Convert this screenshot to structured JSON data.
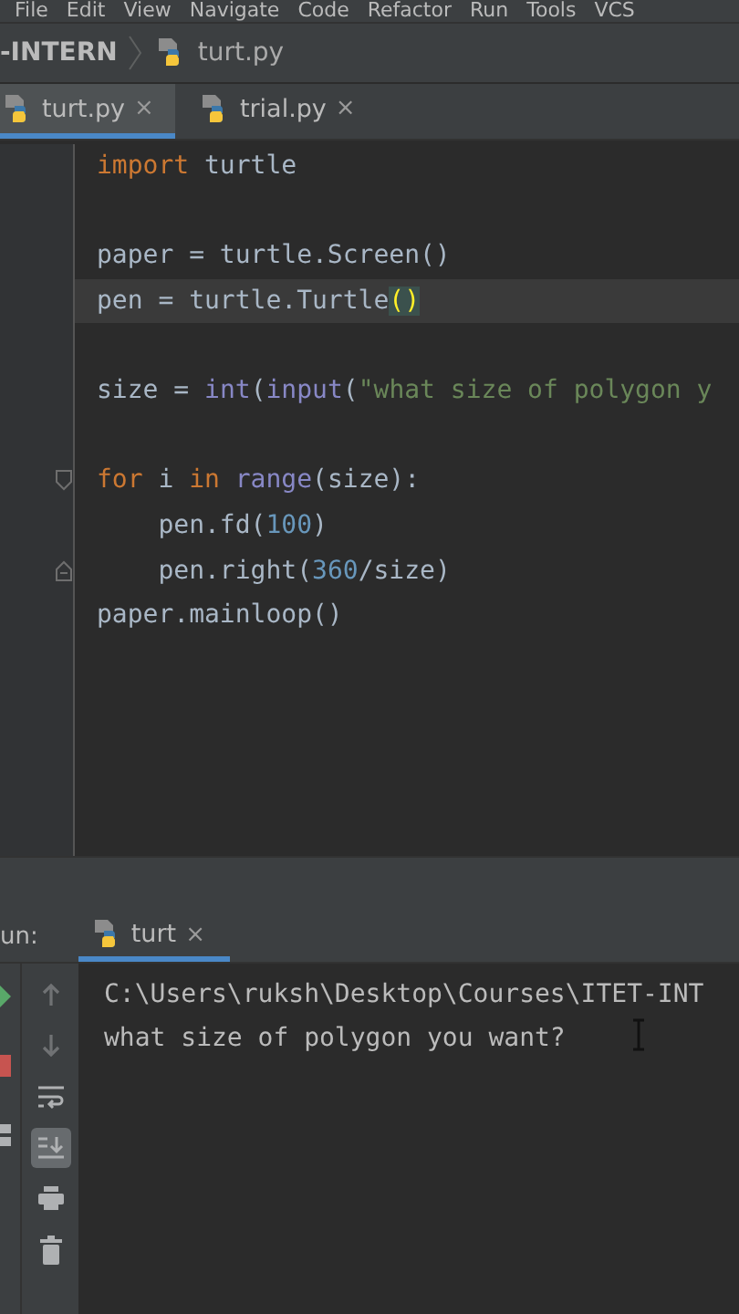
{
  "menu": [
    "File",
    "Edit",
    "View",
    "Navigate",
    "Code",
    "Refactor",
    "Run",
    "Tools",
    "VCS"
  ],
  "breadcrumb": {
    "project": "-INTERN",
    "file": "turt.py"
  },
  "tabs": [
    {
      "label": "turt.py",
      "selected": true,
      "close": "×"
    },
    {
      "label": "trial.py",
      "selected": false,
      "close": "×"
    }
  ],
  "code": [
    {
      "kind": "code",
      "current": false,
      "tokens": [
        {
          "kind": "keyword",
          "text": "import"
        },
        {
          "kind": "plain",
          "text": " turtle"
        }
      ]
    },
    {
      "kind": "blank",
      "current": false
    },
    {
      "kind": "code",
      "current": false,
      "tokens": [
        {
          "kind": "plain",
          "text": "paper = turtle.Screen()"
        }
      ]
    },
    {
      "kind": "code",
      "current": true,
      "tokens": [
        {
          "kind": "plain",
          "text": "pen = turtle.Turtle"
        },
        {
          "kind": "match",
          "text": "()"
        }
      ]
    },
    {
      "kind": "blank",
      "current": false
    },
    {
      "kind": "code",
      "current": false,
      "tokens": [
        {
          "kind": "plain",
          "text": "size = "
        },
        {
          "kind": "builtin",
          "text": "int"
        },
        {
          "kind": "plain",
          "text": "("
        },
        {
          "kind": "builtin",
          "text": "input"
        },
        {
          "kind": "plain",
          "text": "("
        },
        {
          "kind": "string",
          "text": "\"what size of polygon y"
        }
      ]
    },
    {
      "kind": "blank",
      "current": false
    },
    {
      "kind": "fold-start",
      "current": false,
      "tokens": [
        {
          "kind": "keyword",
          "text": "for"
        },
        {
          "kind": "plain",
          "text": " i "
        },
        {
          "kind": "keyword",
          "text": "in"
        },
        {
          "kind": "builtin",
          "text": " range"
        },
        {
          "kind": "plain",
          "text": "(size):"
        }
      ]
    },
    {
      "kind": "code",
      "current": false,
      "tokens": [
        {
          "kind": "plain",
          "text": "    pen.fd("
        },
        {
          "kind": "number",
          "text": "100"
        },
        {
          "kind": "plain",
          "text": ")"
        }
      ]
    },
    {
      "kind": "fold-end",
      "current": false,
      "tokens": [
        {
          "kind": "plain",
          "text": "    pen.right("
        },
        {
          "kind": "number",
          "text": "360"
        },
        {
          "kind": "plain",
          "text": "/size)"
        }
      ]
    },
    {
      "kind": "code",
      "current": false,
      "tokens": [
        {
          "kind": "plain",
          "text": "paper.mainloop()"
        }
      ]
    }
  ],
  "run": {
    "label": "un:",
    "tab": {
      "label": "turt",
      "selected": true,
      "close": "×"
    }
  },
  "console": {
    "lines": [
      "C:\\Users\\ruksh\\Desktop\\Courses\\ITET-INT",
      "what size of polygon you want?"
    ]
  },
  "console_tools": [
    {
      "kind": "up",
      "disabled": true,
      "selected": false
    },
    {
      "kind": "down",
      "disabled": true,
      "selected": false
    },
    {
      "kind": "wrap",
      "disabled": false,
      "selected": false
    },
    {
      "kind": "scroll-end",
      "disabled": false,
      "selected": true
    },
    {
      "kind": "print",
      "disabled": false,
      "selected": false
    },
    {
      "kind": "trash",
      "disabled": false,
      "selected": false
    }
  ]
}
